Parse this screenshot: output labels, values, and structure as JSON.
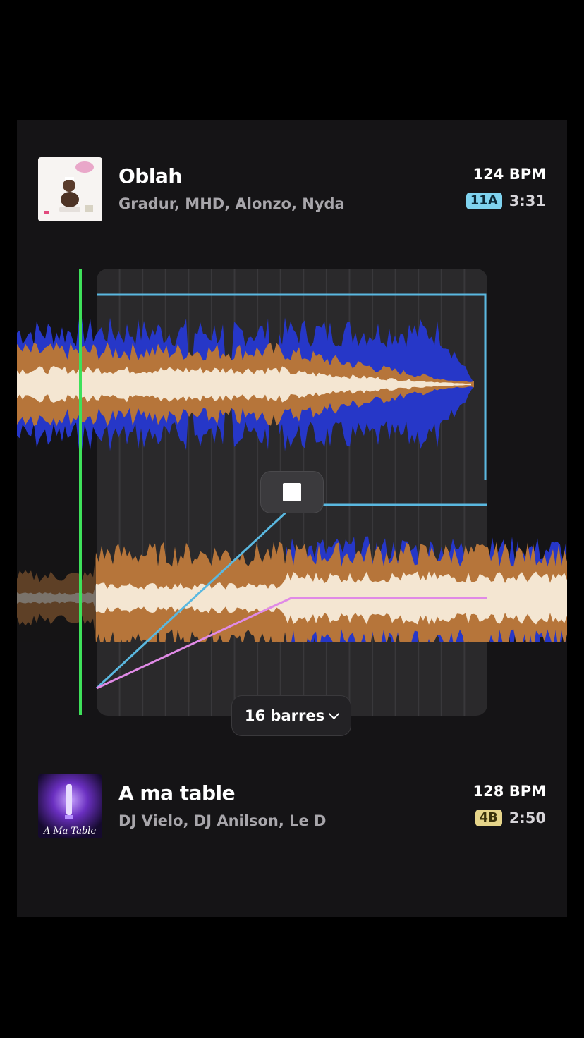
{
  "track_a": {
    "title": "Oblah",
    "artists": "Gradur, MHD, Alonzo, Nyda",
    "bpm": "124 BPM",
    "key": "11A",
    "duration": "3:31",
    "key_color": "#7fd3ef",
    "art_icon": "album-cover-baby-art"
  },
  "track_b": {
    "title": "A ma table",
    "artists": "DJ Vielo, DJ Anilson, Le D",
    "bpm": "128 BPM",
    "key": "4B",
    "duration": "2:50",
    "key_color": "#e6d58a",
    "art_icon": "album-cover-a-ma-table-art",
    "art_text": "A Ma Table"
  },
  "transition": {
    "length_label": "16 barres",
    "playhead_color": "#3ee05a",
    "volume_curve_color": "#5ab8e0",
    "eq_curve_color": "#e08ae6",
    "stop_icon": "stop-icon",
    "dropdown_icon": "chevron-down-icon"
  },
  "waveform_colors": {
    "bass": "#2637c8",
    "mid": "#b6753a",
    "high": "#f4e6d2"
  }
}
